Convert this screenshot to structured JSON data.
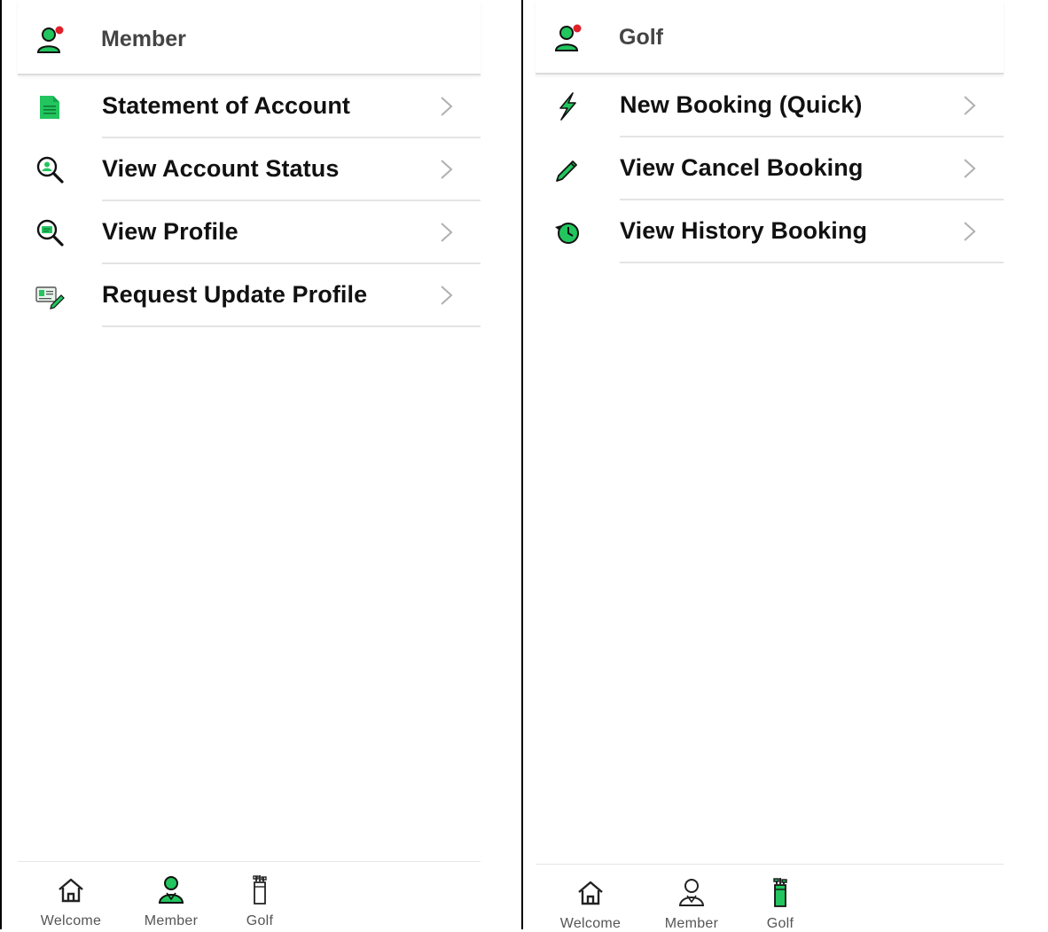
{
  "colors": {
    "accent_green": "#22c55e",
    "notification_red": "#e0202a",
    "divider": "#e4e4e4",
    "chevron": "#b0b0b0"
  },
  "screens": [
    {
      "header": {
        "title": "Member",
        "icon": "user-alert-icon"
      },
      "menu": [
        {
          "label": "Statement of Account",
          "icon": "document-icon"
        },
        {
          "label": "View Account Status",
          "icon": "search-user-icon"
        },
        {
          "label": "View Profile",
          "icon": "search-card-icon"
        },
        {
          "label": "Request Update Profile",
          "icon": "edit-card-icon"
        }
      ],
      "tabs": [
        {
          "label": "Welcome",
          "icon": "home-icon",
          "active": false
        },
        {
          "label": "Member",
          "icon": "user-icon",
          "active": true
        },
        {
          "label": "Golf",
          "icon": "golf-bag-icon",
          "active": false
        }
      ]
    },
    {
      "header": {
        "title": "Golf",
        "icon": "user-alert-icon"
      },
      "menu": [
        {
          "label": "New Booking (Quick)",
          "icon": "lightning-icon"
        },
        {
          "label": "View Cancel Booking",
          "icon": "pencil-icon"
        },
        {
          "label": "View History Booking",
          "icon": "history-icon"
        }
      ],
      "tabs": [
        {
          "label": "Welcome",
          "icon": "home-icon",
          "active": false
        },
        {
          "label": "Member",
          "icon": "user-icon",
          "active": false
        },
        {
          "label": "Golf",
          "icon": "golf-bag-icon",
          "active": true
        }
      ]
    }
  ]
}
